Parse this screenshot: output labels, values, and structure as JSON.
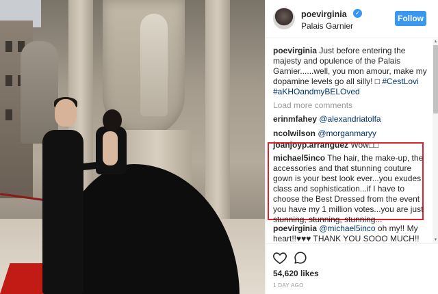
{
  "post": {
    "username": "poevirginia",
    "location": "Palais Garnier",
    "follow_label": "Follow",
    "verified": true
  },
  "caption": {
    "username": "poevirginia",
    "text": "Just before entering the majesty and opulence of the Palais Garnier......well, you mon amour, make my dopamine levels go all silly! □ ",
    "tags": "#CestLovi #aKHOandmyBELOved"
  },
  "load_more_label": "Load more comments",
  "comments": [
    {
      "username": "erinmfahey",
      "text": "@alexandriatolfa"
    },
    {
      "username": "ncolwilson",
      "text": "@morganmaryy"
    },
    {
      "username": "joanjoyp.arranguez",
      "text": "Wow□□"
    },
    {
      "username": "michael5inco",
      "text": "The hair, the make-up, the accessories and that stunning couture gown is your best look ever...you exudes class and sophistication...if I have to choose the Best Dressed from the event you have my 1 million votes...you are just stunning, stunning, stunning..."
    },
    {
      "username": "poevirginia",
      "mention": "@michael5inco",
      "text": " oh my!! My heart!!♥♥♥ THANK YOU SOOO MUCH!!□□"
    }
  ],
  "likes": "54,620 likes",
  "time_ago": "1 DAY AGO",
  "icons": {
    "like": "heart-icon",
    "comment": "comment-icon",
    "verified": "verified-badge-icon"
  },
  "colors": {
    "accent": "#3897f0",
    "highlight": "#e0212b",
    "link": "#003569"
  }
}
